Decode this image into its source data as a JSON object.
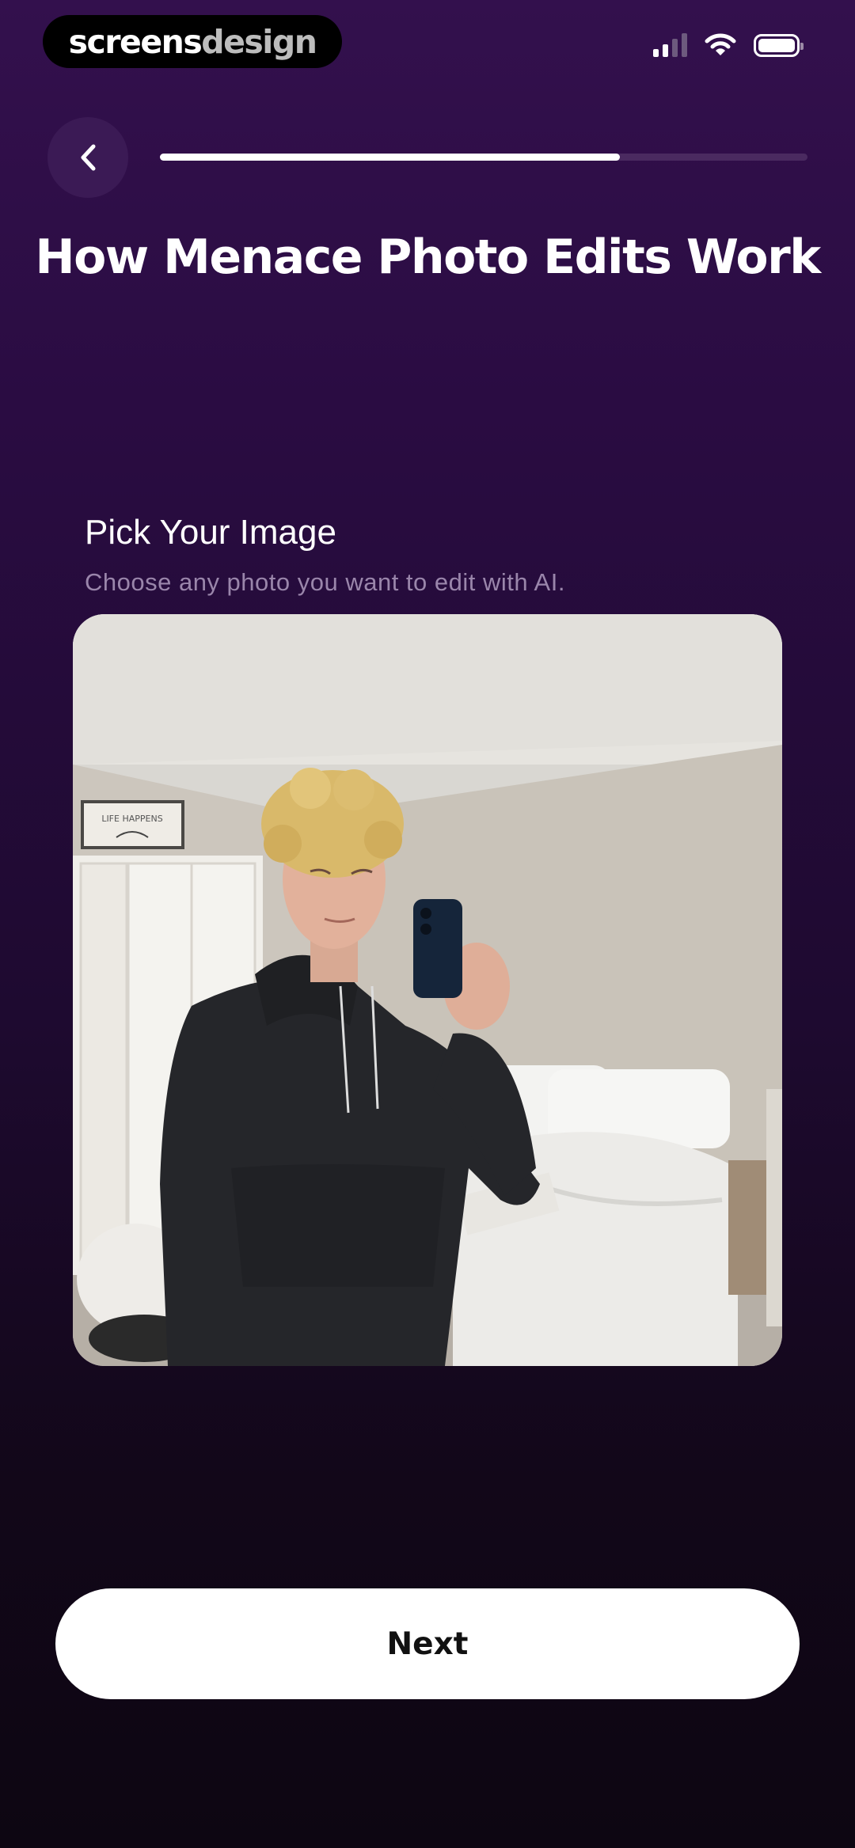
{
  "status_bar": {
    "brand_part1": "screens",
    "brand_part2": "design",
    "icons": [
      "signal-icon",
      "wifi-icon",
      "battery-icon"
    ]
  },
  "nav": {
    "back_icon": "chevron-left-icon",
    "progress": 0.71
  },
  "page": {
    "title": "How Menace Photo Edits Work"
  },
  "step": {
    "title": "Pick Your Image",
    "description": "Choose any photo you want to edit with AI.",
    "photo_sign_text": "LIFE HAPPENS"
  },
  "actions": {
    "next_label": "Next"
  },
  "colors": {
    "background_top": "#33104d",
    "background_bottom": "#0d0612",
    "progress_track": "#4a2a60",
    "button_bg": "#ffffff",
    "subtitle_text": "#9a86ab"
  }
}
